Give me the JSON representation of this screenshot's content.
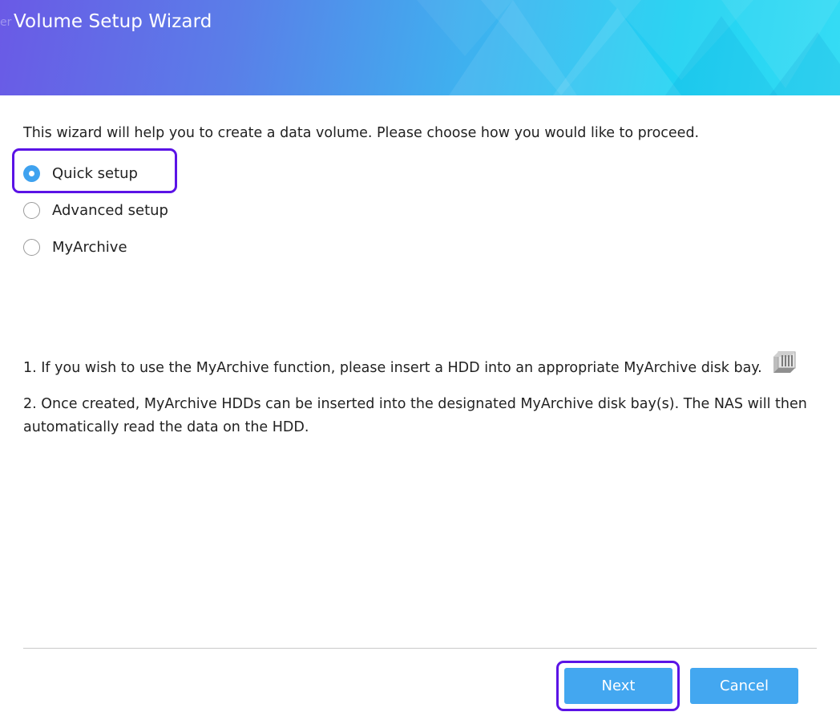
{
  "window": {
    "title": "Volume Setup Wizard",
    "title_ghost": "er"
  },
  "intro": "This wizard will help you to create a data volume. Please choose how you would like to proceed.",
  "options": [
    {
      "label": "Quick setup",
      "selected": true
    },
    {
      "label": "Advanced setup",
      "selected": false
    },
    {
      "label": "MyArchive",
      "selected": false
    }
  ],
  "notes": {
    "note1": "1. If you wish to use the MyArchive function, please insert a HDD into an appropriate MyArchive disk bay.",
    "note1_icon": "hdd-disk-icon",
    "note2": "2. Once created, MyArchive HDDs can be inserted into the designated MyArchive disk bay(s). The NAS will then automatically read the data on the HDD."
  },
  "buttons": {
    "next": "Next",
    "cancel": "Cancel"
  },
  "colors": {
    "header_gradient_start": "#6a5ae6",
    "header_gradient_end": "#36dcf4",
    "accent": "#43a7f0",
    "highlight": "#5b13e6"
  }
}
